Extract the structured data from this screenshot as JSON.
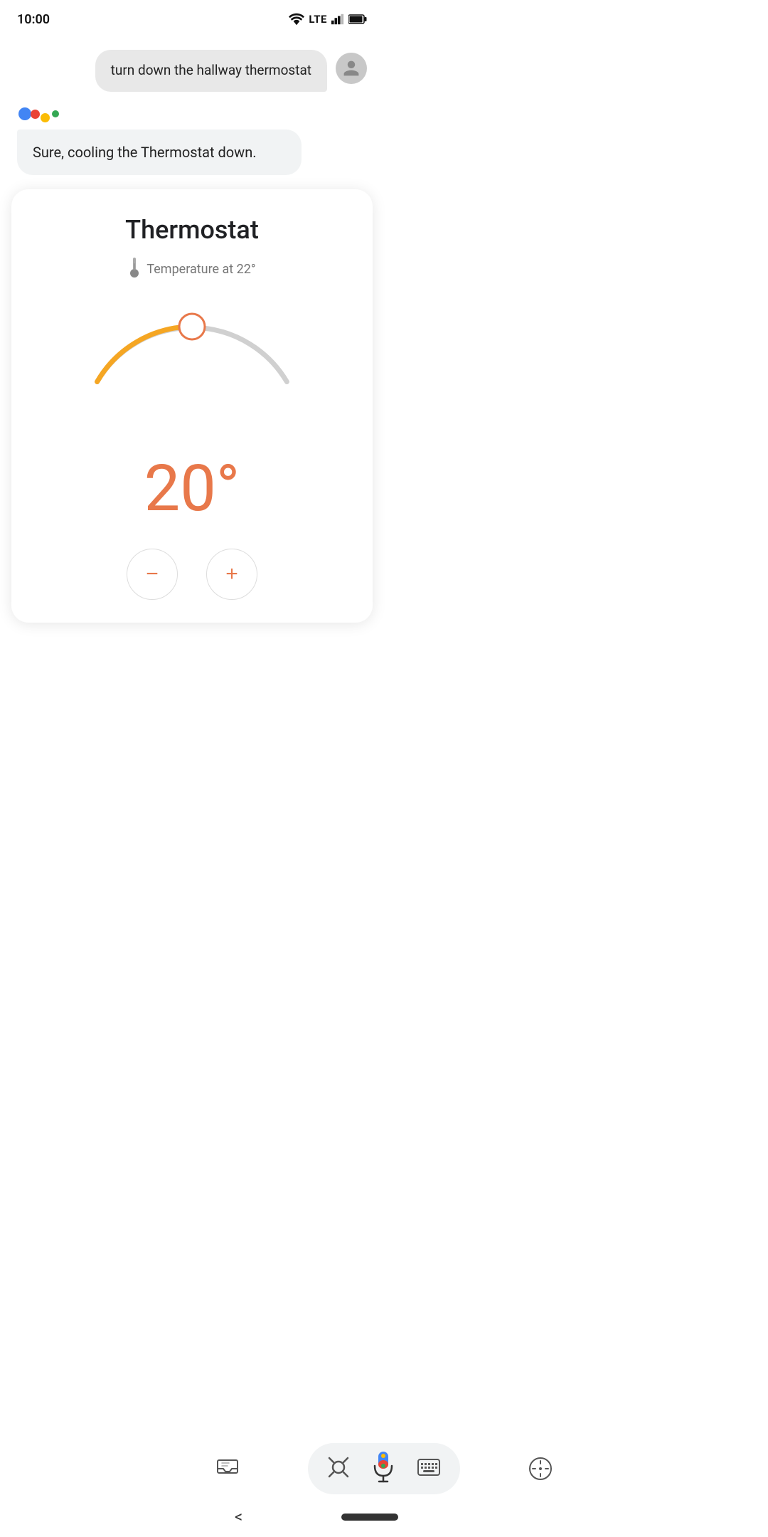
{
  "status_bar": {
    "time": "10:00",
    "wifi": true,
    "lte": true,
    "signal": true,
    "battery": true
  },
  "user_message": {
    "text": "turn down the hallway thermostat"
  },
  "assistant_response": {
    "text": "Sure, cooling the Thermostat down."
  },
  "thermostat": {
    "title": "Thermostat",
    "temp_label": "Temperature at 22°",
    "current_temp": "20°",
    "set_temp": 22,
    "current_set": 20,
    "min_temp": 10,
    "max_temp": 30
  },
  "controls": {
    "decrease_label": "−",
    "increase_label": "+"
  },
  "nav": {
    "back_label": "<"
  }
}
